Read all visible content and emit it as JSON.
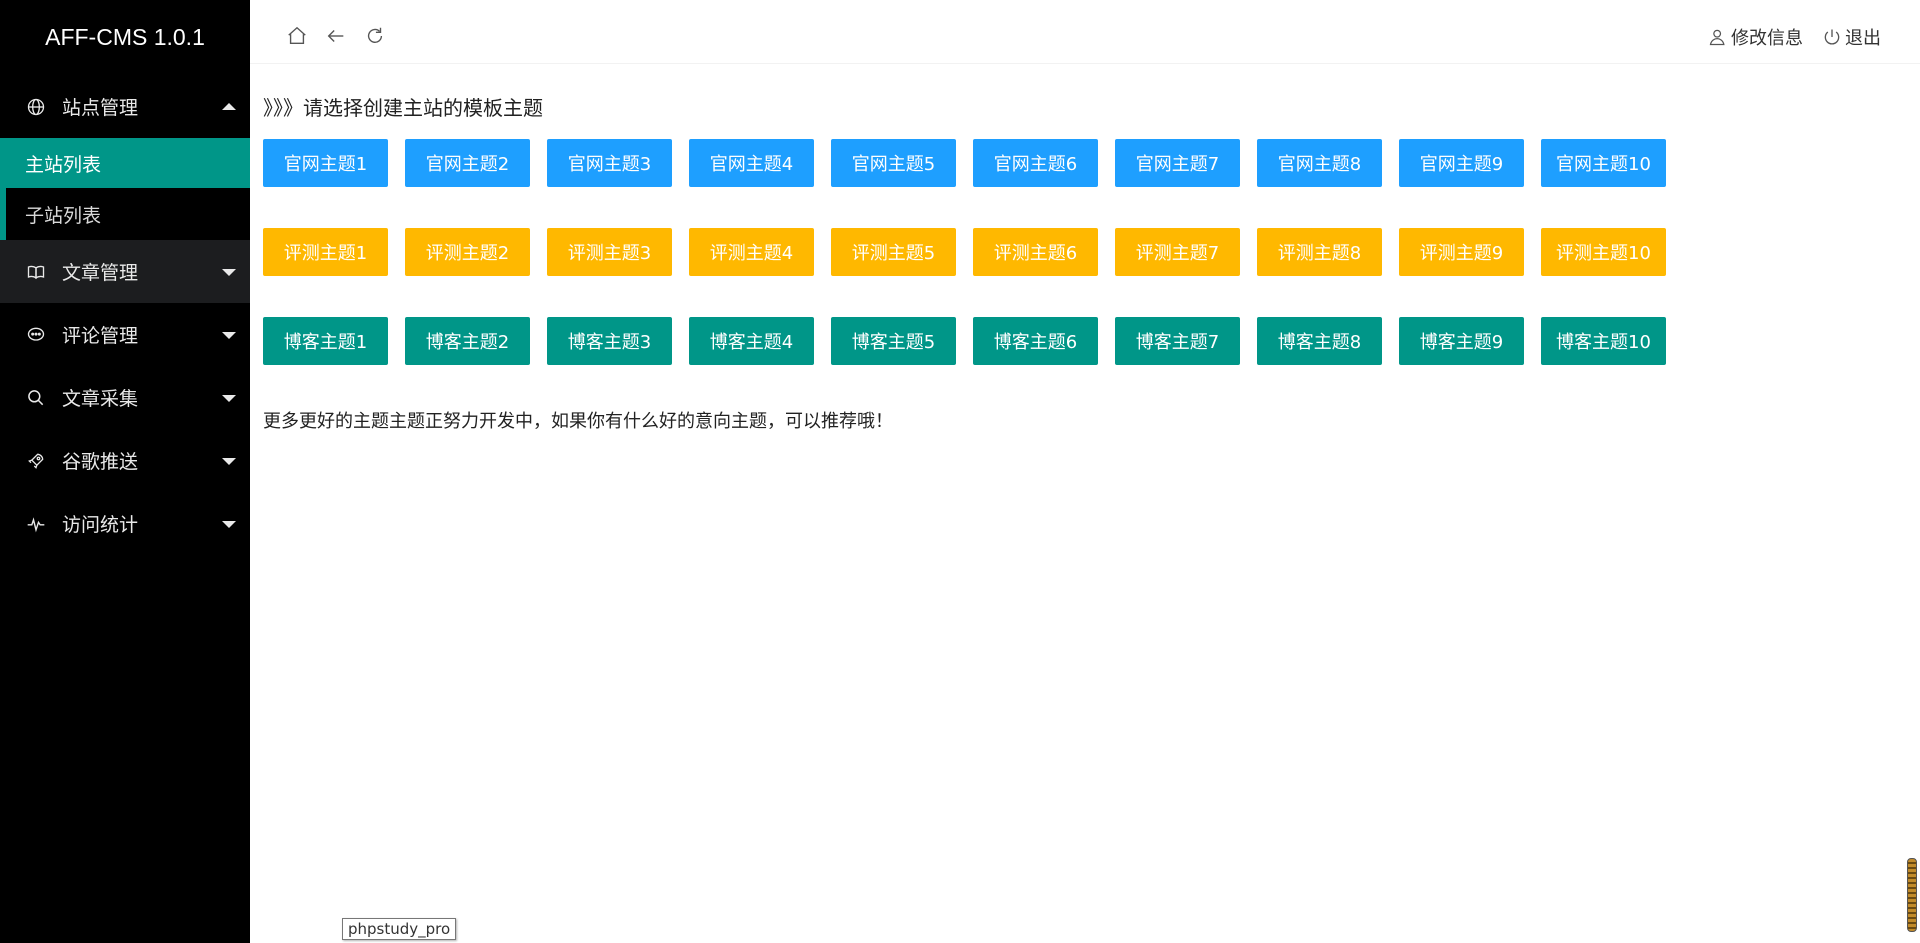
{
  "app": {
    "brand": "AFF-CMS 1.0.1"
  },
  "sidebar": {
    "groups": [
      {
        "label": "站点管理",
        "icon": "globe-icon",
        "expanded": true
      },
      {
        "label": "文章管理",
        "icon": "book-icon",
        "expanded": false
      },
      {
        "label": "评论管理",
        "icon": "chat-icon",
        "expanded": false
      },
      {
        "label": "文章采集",
        "icon": "search-icon",
        "expanded": false
      },
      {
        "label": "谷歌推送",
        "icon": "rocket-icon",
        "expanded": false
      },
      {
        "label": "访问统计",
        "icon": "pulse-icon",
        "expanded": false
      }
    ],
    "subitems": [
      {
        "label": "主站列表",
        "active": true
      },
      {
        "label": "子站列表",
        "active": false
      }
    ]
  },
  "header": {
    "edit_info": "修改信息",
    "logout": "退出",
    "icons": [
      "home-icon",
      "back-icon",
      "refresh-icon"
    ]
  },
  "main": {
    "title": "》》》请选择创建主站的模板主题",
    "official": [
      "官网主题1",
      "官网主题2",
      "官网主题3",
      "官网主题4",
      "官网主题5",
      "官网主题6",
      "官网主题7",
      "官网主题8",
      "官网主题9",
      "官网主题10"
    ],
    "review": [
      "评测主题1",
      "评测主题2",
      "评测主题3",
      "评测主题4",
      "评测主题5",
      "评测主题6",
      "评测主题7",
      "评测主题8",
      "评测主题9",
      "评测主题10"
    ],
    "blog": [
      "博客主题1",
      "博客主题2",
      "博客主题3",
      "博客主题4",
      "博客主题5",
      "博客主题6",
      "博客主题7",
      "博客主题8",
      "博客主题9",
      "博客主题10"
    ],
    "note": "更多更好的主题主题正努力开发中，如果你有什么好的意向主题，可以推荐哦！"
  },
  "tooltip": "phpstudy_pro",
  "colors": {
    "sidebar_bg": "#000000",
    "accent": "#009688",
    "blue": "#1e9fff",
    "orange": "#ffb800"
  }
}
